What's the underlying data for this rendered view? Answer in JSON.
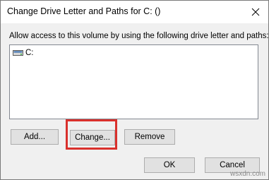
{
  "window": {
    "title": "Change Drive Letter and Paths for C: ()",
    "close_icon": "close-icon"
  },
  "instruction": "Allow access to this volume by using the following drive letter and paths:",
  "list": {
    "items": [
      {
        "label": "C:",
        "icon": "drive-icon"
      }
    ]
  },
  "buttons": {
    "add": "Add...",
    "change": "Change...",
    "remove": "Remove",
    "ok": "OK",
    "cancel": "Cancel"
  },
  "annotation": {
    "highlight_color": "#d9302c",
    "highlighted_button": "change"
  },
  "watermark": "wsxdn.com",
  "colors": {
    "dialog_bg": "#f0f0f0",
    "titlebar_bg": "#ffffff",
    "button_bg": "#e1e1e1",
    "button_border": "#adadad"
  }
}
